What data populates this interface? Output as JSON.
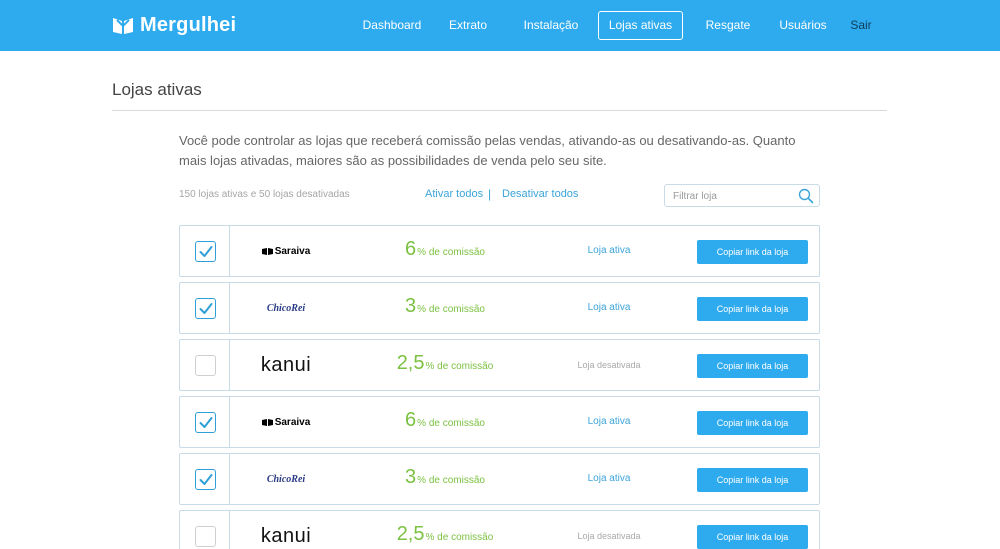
{
  "brand": {
    "name": "Mergulhei",
    "color": "#2eaaee"
  },
  "nav": [
    {
      "label": "Dashboard",
      "active": false
    },
    {
      "label": "Extrato",
      "active": false
    },
    {
      "label": "Instalação",
      "active": false
    },
    {
      "label": "Lojas ativas",
      "active": true
    },
    {
      "label": "Resgate",
      "active": false
    },
    {
      "label": "Usuários",
      "active": false
    },
    {
      "label": "Sair",
      "active": false
    }
  ],
  "page": {
    "title": "Lojas ativas",
    "intro": "Você pode controlar as lojas que receberá comissão pelas vendas, ativando-as ou desativando-as. Quanto mais lojas ativadas, maiores são as possibilidades de venda pelo seu site."
  },
  "summary": {
    "counts": "150 lojas ativas e 50 lojas desativadas",
    "activate_all": "Ativar todos",
    "separator": "|",
    "deactivate_all": "Desativar todos",
    "filter_placeholder": "Filtrar loja",
    "search_icon": "search-icon"
  },
  "stores": [
    {
      "logo": "Saraiva",
      "checked": true,
      "commission_value": "6",
      "commission_suffix": "% de comissão",
      "status": "Loja ativa",
      "active": true,
      "button": "Copiar link da loja"
    },
    {
      "logo": "ChicoRei",
      "checked": true,
      "commission_value": "3",
      "commission_suffix": "% de comissão",
      "status": "Loja ativa",
      "active": true,
      "button": "Copiar link da loja"
    },
    {
      "logo": "kanui",
      "checked": false,
      "commission_value": "2,5",
      "commission_suffix": "% de comissão",
      "status": "Loja desativada",
      "active": false,
      "button": "Copiar link da loja"
    },
    {
      "logo": "Saraiva",
      "checked": true,
      "commission_value": "6",
      "commission_suffix": "% de comissão",
      "status": "Loja ativa",
      "active": true,
      "button": "Copiar link da loja"
    },
    {
      "logo": "ChicoRei",
      "checked": true,
      "commission_value": "3",
      "commission_suffix": "% de comissão",
      "status": "Loja ativa",
      "active": true,
      "button": "Copiar link da loja"
    },
    {
      "logo": "kanui",
      "checked": false,
      "commission_value": "2,5",
      "commission_suffix": "% de comissão",
      "status": "Loja desativada",
      "active": false,
      "button": "Copiar link da loja"
    }
  ],
  "colors": {
    "accent": "#2eaaee",
    "commission": "#7cc142",
    "active_status": "#3ba4d9",
    "inactive_status": "#a9a9a9"
  }
}
